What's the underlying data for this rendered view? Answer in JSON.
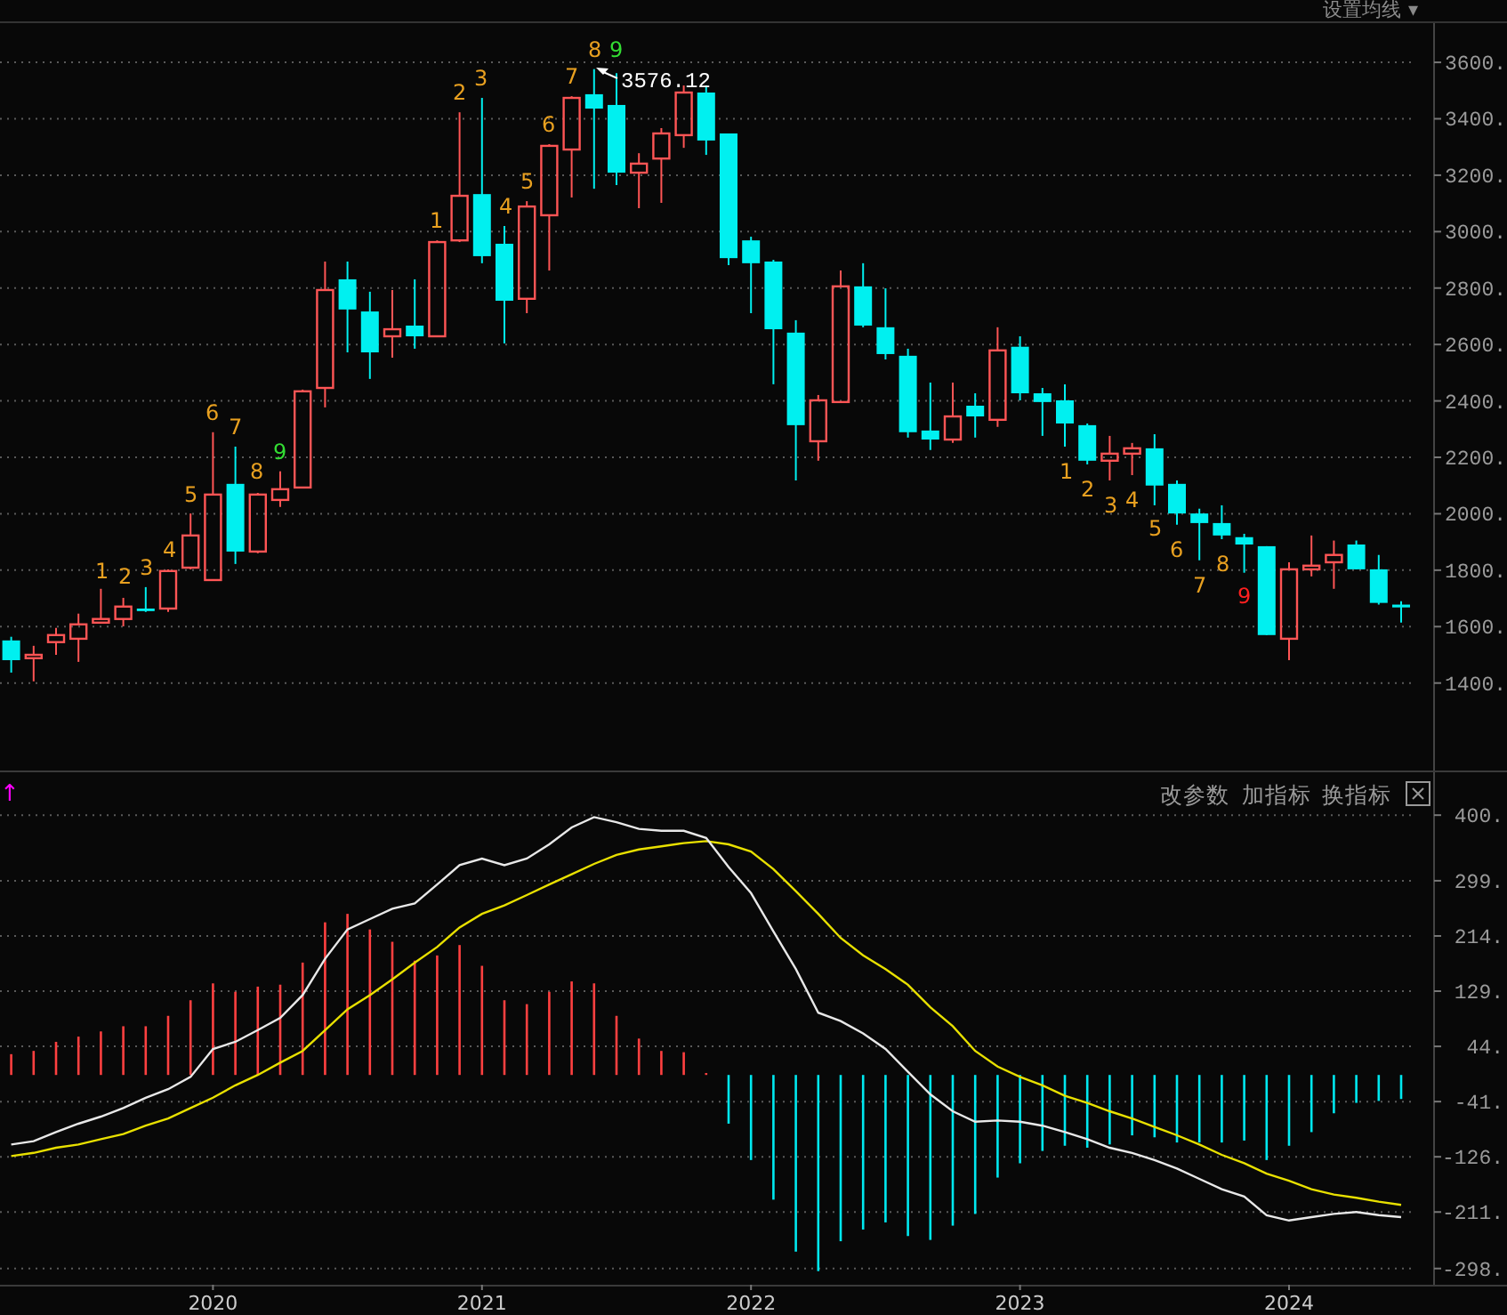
{
  "indicator_menu": {
    "label": "设置均线",
    "caret": "▾"
  },
  "price_chart": {
    "high_label": "3576.12",
    "chart_data": {
      "type": "candlestick",
      "grid": true,
      "ylim": [
        1090,
        3739
      ],
      "yticks": [
        {
          "value": 3600,
          "label": "3600."
        },
        {
          "value": 3400,
          "label": "3400."
        },
        {
          "value": 3200,
          "label": "3200."
        },
        {
          "value": 3000,
          "label": "3000."
        },
        {
          "value": 2800,
          "label": "2800."
        },
        {
          "value": 2600,
          "label": "2600."
        },
        {
          "value": 2400,
          "label": "2400."
        },
        {
          "value": 2200,
          "label": "2200."
        },
        {
          "value": 2000,
          "label": "2000."
        },
        {
          "value": 1800,
          "label": "1800."
        },
        {
          "value": 1600,
          "label": "1600."
        },
        {
          "value": 1400,
          "label": "1400."
        }
      ],
      "categories": [
        null,
        null,
        null,
        null,
        null,
        null,
        null,
        null,
        null,
        null,
        null,
        null,
        null,
        null,
        null,
        null,
        null,
        null,
        null,
        null,
        null,
        null,
        null,
        null,
        null,
        null,
        null,
        null,
        null,
        null,
        null,
        null,
        null,
        null,
        null,
        null,
        null,
        null,
        null,
        null,
        null,
        null,
        null,
        null,
        null,
        null,
        null,
        null,
        null,
        null,
        null,
        null,
        null,
        null,
        null,
        null,
        null,
        null,
        null,
        null,
        null,
        null,
        null
      ],
      "ohlc": [
        [
          1551,
          1564,
          1437,
          1481
        ],
        [
          1488,
          1532,
          1406,
          1500
        ],
        [
          1545,
          1595,
          1500,
          1570
        ],
        [
          1557,
          1646,
          1475,
          1608
        ],
        [
          1614,
          1734,
          1614,
          1627
        ],
        [
          1627,
          1702,
          1601,
          1671
        ],
        [
          1664,
          1740,
          1652,
          1655
        ],
        [
          1664,
          1803,
          1652,
          1797
        ],
        [
          1809,
          2001,
          1803,
          1923
        ],
        [
          1765,
          2289,
          1765,
          2068
        ],
        [
          2106,
          2238,
          1822,
          1866
        ],
        [
          1866,
          2074,
          1860,
          2068
        ],
        [
          2049,
          2150,
          2024,
          2087
        ],
        [
          2093,
          2440,
          2093,
          2434
        ],
        [
          2446,
          2894,
          2377,
          2793
        ],
        [
          2831,
          2894,
          2572,
          2724
        ],
        [
          2717,
          2787,
          2478,
          2572
        ],
        [
          2629,
          2793,
          2553,
          2654
        ],
        [
          2667,
          2831,
          2585,
          2629
        ],
        [
          2629,
          2969,
          2629,
          2963
        ],
        [
          2969,
          3423,
          2963,
          3127
        ],
        [
          3133,
          3474,
          2888,
          2913
        ],
        [
          2957,
          3020,
          2604,
          2755
        ],
        [
          2762,
          3108,
          2711,
          3089
        ],
        [
          3058,
          3310,
          2862,
          3304
        ],
        [
          3291,
          3480,
          3121,
          3474
        ],
        [
          3487,
          3576,
          3152,
          3436
        ],
        [
          3449,
          3562,
          3165,
          3209
        ],
        [
          3209,
          3278,
          3083,
          3241
        ],
        [
          3259,
          3367,
          3102,
          3348
        ],
        [
          3342,
          3518,
          3297,
          3493
        ],
        [
          3493,
          3518,
          3272,
          3323
        ],
        [
          3348,
          3348,
          2881,
          2906
        ],
        [
          2969,
          2982,
          2711,
          2888
        ],
        [
          2894,
          2900,
          2459,
          2654
        ],
        [
          2642,
          2686,
          2118,
          2314
        ],
        [
          2257,
          2421,
          2188,
          2402
        ],
        [
          2396,
          2862,
          2396,
          2806
        ],
        [
          2806,
          2888,
          2661,
          2667
        ],
        [
          2661,
          2799,
          2547,
          2566
        ],
        [
          2560,
          2585,
          2270,
          2289
        ],
        [
          2295,
          2465,
          2226,
          2263
        ],
        [
          2263,
          2465,
          2251,
          2345
        ],
        [
          2383,
          2427,
          2270,
          2345
        ],
        [
          2333,
          2661,
          2308,
          2579
        ],
        [
          2592,
          2629,
          2402,
          2427
        ],
        [
          2427,
          2446,
          2276,
          2396
        ],
        [
          2402,
          2459,
          2238,
          2320
        ],
        [
          2314,
          2320,
          2175,
          2188
        ],
        [
          2188,
          2276,
          2118,
          2213
        ],
        [
          2213,
          2251,
          2137,
          2232
        ],
        [
          2232,
          2282,
          2030,
          2100
        ],
        [
          2106,
          2118,
          1961,
          2001
        ],
        [
          2001,
          2018,
          1835,
          1967
        ],
        [
          1967,
          2030,
          1910,
          1923
        ],
        [
          1917,
          1929,
          1791,
          1891
        ],
        [
          1885,
          1885,
          1570,
          1570
        ],
        [
          1557,
          1828,
          1481,
          1803
        ],
        [
          1803,
          1923,
          1778,
          1816
        ],
        [
          1828,
          1905,
          1734,
          1854
        ],
        [
          1891,
          1905,
          1803,
          1803
        ],
        [
          1803,
          1854,
          1678,
          1684
        ],
        [
          1678,
          1690,
          1614,
          1668
        ]
      ]
    },
    "td_marks": [
      {
        "text": "1",
        "color": "#e8a020"
      },
      {
        "text": "2",
        "color": "#e8a020"
      },
      {
        "text": "3",
        "color": "#e8a020"
      },
      {
        "text": "4",
        "color": "#e8a020"
      },
      {
        "text": "5",
        "color": "#e8a020"
      },
      {
        "text": "6",
        "color": "#e8a020"
      },
      {
        "text": "7",
        "color": "#e8a020"
      },
      {
        "text": "8",
        "color": "#e8a020"
      },
      {
        "text": "9",
        "color": "#33dd33"
      },
      {
        "text": "1",
        "color": "#e8a020"
      },
      {
        "text": "2",
        "color": "#e8a020"
      },
      {
        "text": "3",
        "color": "#e8a020"
      },
      {
        "text": "4",
        "color": "#e8a020"
      },
      {
        "text": "5",
        "color": "#e8a020"
      },
      {
        "text": "6",
        "color": "#e8a020"
      },
      {
        "text": "7",
        "color": "#e8a020"
      },
      {
        "text": "8",
        "color": "#e8a020"
      },
      {
        "text": "9",
        "color": "#33dd33"
      },
      {
        "text": "1",
        "color": "#e8a020"
      },
      {
        "text": "2",
        "color": "#e8a020"
      },
      {
        "text": "3",
        "color": "#e8a020"
      },
      {
        "text": "4",
        "color": "#e8a020"
      },
      {
        "text": "5",
        "color": "#e8a020"
      },
      {
        "text": "6",
        "color": "#e8a020"
      },
      {
        "text": "7",
        "color": "#e8a020"
      },
      {
        "text": "8",
        "color": "#e8a020"
      },
      {
        "text": "9",
        "color": "#ff2020"
      }
    ]
  },
  "macd_panel": {
    "arrow": "↑",
    "buttons": [
      "改参数",
      "加指标",
      "换指标"
    ],
    "chart_data": {
      "type": "bar",
      "grid": true,
      "ylim": [
        -323,
        466
      ],
      "categories": [
        null,
        null,
        null,
        null,
        null,
        null,
        null,
        null,
        null,
        "2020",
        null,
        null,
        null,
        null,
        null,
        null,
        null,
        null,
        null,
        null,
        null,
        "2021",
        null,
        null,
        null,
        null,
        null,
        null,
        null,
        null,
        null,
        null,
        null,
        "2022",
        null,
        null,
        null,
        null,
        null,
        null,
        null,
        null,
        null,
        null,
        null,
        "2023",
        null,
        null,
        null,
        null,
        null,
        null,
        null,
        null,
        null,
        null,
        null,
        "2024",
        null,
        null,
        null,
        null,
        null
      ],
      "yticks": [
        {
          "value": 400,
          "label": "400."
        },
        {
          "value": 299,
          "label": "299."
        },
        {
          "value": 214,
          "label": "214."
        },
        {
          "value": 129,
          "label": "129."
        },
        {
          "value": 44,
          "label": "44."
        },
        {
          "value": -41,
          "label": "-41."
        },
        {
          "value": -126,
          "label": "-126."
        },
        {
          "value": -211,
          "label": "-211."
        },
        {
          "value": -298,
          "label": "-298."
        }
      ],
      "series": [
        {
          "color": "#ff4040",
          "values": [
            32,
            37,
            51,
            59,
            67,
            75,
            75,
            91,
            115,
            141,
            128,
            136,
            139,
            173,
            235,
            248,
            224,
            205,
            176,
            184,
            200,
            168,
            115,
            109,
            128,
            144,
            141,
            91,
            56,
            37,
            35,
            3,
            null,
            null,
            null,
            null,
            null,
            null,
            null,
            null,
            null,
            null,
            null,
            null,
            null,
            null,
            null,
            null,
            null,
            null,
            null,
            null,
            null,
            null,
            null,
            null,
            null,
            null,
            null,
            null,
            null,
            null,
            null
          ]
        },
        {
          "color": "#00e8f0",
          "values": [
            null,
            null,
            null,
            null,
            null,
            null,
            null,
            null,
            null,
            null,
            null,
            null,
            null,
            null,
            null,
            null,
            null,
            null,
            null,
            null,
            null,
            null,
            null,
            null,
            null,
            null,
            null,
            null,
            null,
            null,
            null,
            null,
            -75,
            -131,
            -192,
            -272,
            -302,
            -256,
            -238,
            -227,
            -248,
            -254,
            -232,
            -214,
            -158,
            -136,
            -117,
            -109,
            -112,
            -107,
            -93,
            -96,
            -104,
            -104,
            -104,
            -101,
            -131,
            -109,
            -88,
            -59,
            -43,
            -40,
            -37
          ]
        },
        {
          "type": "line",
          "color": "#e8e000",
          "values": [
            -125,
            -120,
            -112,
            -107,
            -99,
            -91,
            -78,
            -67,
            -51,
            -35,
            -16,
            0,
            19,
            37,
            69,
            101,
            123,
            147,
            173,
            197,
            227,
            248,
            261,
            277,
            293,
            309,
            325,
            339,
            347,
            352,
            357,
            360,
            355,
            344,
            317,
            283,
            248,
            211,
            184,
            163,
            139,
            104,
            75,
            37,
            13,
            -3,
            -16,
            -32,
            -43,
            -56,
            -67,
            -80,
            -93,
            -107,
            -123,
            -136,
            -152,
            -163,
            -176,
            -184,
            -189,
            -195,
            -200
          ]
        },
        {
          "type": "line",
          "color": "#e8e8e8",
          "values": [
            -107,
            -102,
            -88,
            -75,
            -64,
            -51,
            -35,
            -22,
            -3,
            40,
            51,
            69,
            88,
            123,
            179,
            224,
            240,
            256,
            264,
            293,
            323,
            333,
            323,
            333,
            355,
            381,
            397,
            389,
            379,
            376,
            376,
            365,
            320,
            280,
            221,
            163,
            96,
            83,
            64,
            40,
            5,
            -30,
            -56,
            -72,
            -70,
            -72,
            -78,
            -88,
            -99,
            -112,
            -120,
            -131,
            -144,
            -160,
            -176,
            -187,
            -216,
            -224,
            -219,
            -214,
            -211,
            -216,
            -219
          ]
        }
      ]
    }
  }
}
